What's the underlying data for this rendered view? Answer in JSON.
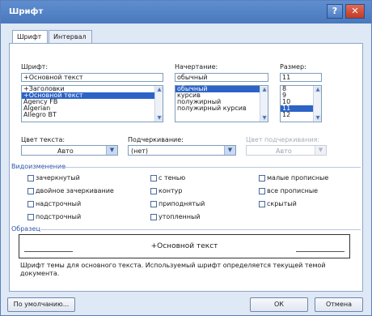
{
  "window": {
    "title": "Шрифт",
    "help_icon": "?",
    "close_icon": "✕"
  },
  "tabs": [
    {
      "label": "Шрифт",
      "active": true
    },
    {
      "label": "Интервал",
      "active": false
    }
  ],
  "font": {
    "label": "Шрифт:",
    "value": "+Основной текст",
    "items": [
      "+Заголовки",
      "+Основной текст",
      "Agency FB",
      "Algerian",
      "Allegro BT"
    ],
    "selected_index": 1
  },
  "style": {
    "label": "Начертание:",
    "value": "обычный",
    "items": [
      "обычный",
      "курсив",
      "полужирный",
      "полужирный курсив"
    ],
    "selected_index": 0
  },
  "size": {
    "label": "Размер:",
    "value": "11",
    "items": [
      "8",
      "9",
      "10",
      "11",
      "12"
    ],
    "selected_index": 3
  },
  "text_color": {
    "label": "Цвет текста:",
    "value": "Авто"
  },
  "underline": {
    "label": "Подчеркивание:",
    "value": "(нет)"
  },
  "underline_color": {
    "label": "Цвет подчеркивания:",
    "value": "Авто"
  },
  "effects": {
    "title": "Видоизменение",
    "items": [
      "зачеркнутый",
      "двойное зачеркивание",
      "надстрочный",
      "подстрочный",
      "с тенью",
      "контур",
      "приподнятый",
      "утопленный",
      "малые прописные",
      "все прописные",
      "скрытый"
    ]
  },
  "preview": {
    "title": "Образец",
    "text": "+Основной текст",
    "description": "Шрифт темы для основного текста. Используемый шрифт определяется текущей темой документа."
  },
  "buttons": {
    "default": "По умолчанию...",
    "ok": "ОК",
    "cancel": "Отмена"
  },
  "colors": {
    "titlebar": "#4a78bc",
    "selection": "#2d63c6",
    "group_title": "#2a56a8"
  }
}
